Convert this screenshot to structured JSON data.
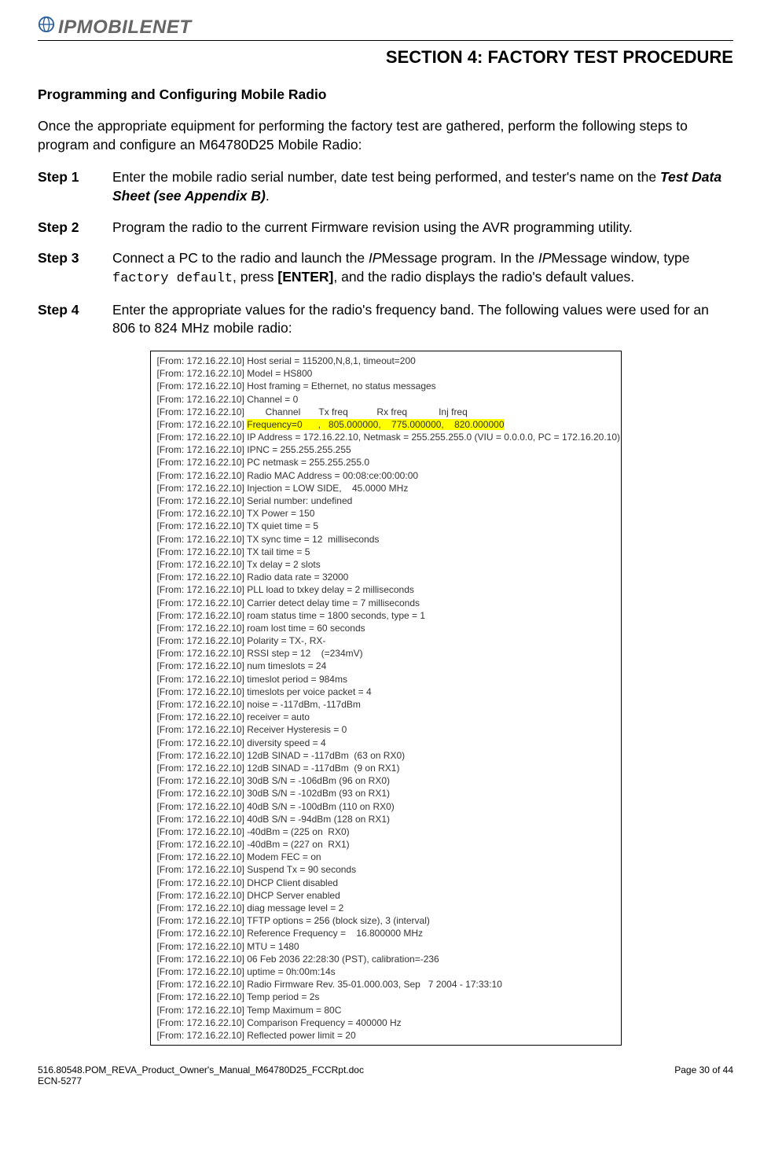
{
  "logo_text": "IPMOBILENET",
  "section_title": "SECTION 4: FACTORY TEST PROCEDURE",
  "subheading": "Programming and Configuring Mobile Radio",
  "intro": "Once the appropriate equipment for performing the factory test are gathered, perform the following steps to program and configure an M64780D25 Mobile Radio:",
  "steps": {
    "s1": {
      "label": "Step 1",
      "a": "Enter the mobile radio serial number, date test being performed, and tester's name on the ",
      "b": "Test Data Sheet (see Appendix B)",
      "c": "."
    },
    "s2": {
      "label": "Step 2",
      "a": "Program the radio to the current Firmware revision using the AVR programming utility."
    },
    "s3": {
      "label": "Step 3",
      "a": "Connect a PC to the radio and launch the ",
      "b": "IP",
      "c": "Message program.  In the ",
      "d": "IP",
      "e": "Message window, type ",
      "f": "factory default",
      "g": ", press ",
      "h": "[ENTER]",
      "i": ", and the radio displays the radio's default values."
    },
    "s4": {
      "label": "Step 4",
      "a": "Enter the appropriate values for the radio's frequency band.  The following values were used for an 806 to 824 MHz mobile radio:"
    }
  },
  "term_prefix": "[From: 172.16.22.10] ",
  "term": {
    "l1": "Host serial = 115200,N,8,1, timeout=200",
    "l2": "Model = HS800",
    "l3": "Host framing = Ethernet, no status messages",
    "l4": "Channel = 0",
    "l5": "       Channel       Tx freq           Rx freq            Inj freq",
    "l6a": "Frequency=0      ,   805.000000,    775.000000,    820.000000",
    "l7": "IP Address = 172.16.22.10, Netmask = 255.255.255.0 (VIU = 0.0.0.0, PC = 172.16.20.10)",
    "l8": "IPNC = 255.255.255.255",
    "l9": "PC netmask = 255.255.255.0",
    "l10": "Radio MAC Address = 00:08:ce:00:00:00",
    "l11": "Injection = LOW SIDE,    45.0000 MHz",
    "l12": "Serial number: undefined",
    "l13": "TX Power = 150",
    "l14": "TX quiet time = 5",
    "l15": "TX sync time = 12  milliseconds",
    "l16": "TX tail time = 5",
    "l17": "Tx delay = 2 slots",
    "l18": "Radio data rate = 32000",
    "l19": "PLL load to txkey delay = 2 milliseconds",
    "l20": "Carrier detect delay time = 7 milliseconds",
    "l21": "roam status time = 1800 seconds, type = 1",
    "l22": "roam lost time = 60 seconds",
    "l23": "Polarity = TX-, RX-",
    "l24": "RSSI step = 12    (=234mV)",
    "l25": "num timeslots = 24",
    "l26": "timeslot period = 984ms",
    "l27": "timeslots per voice packet = 4",
    "l28": "noise = -117dBm, -117dBm",
    "l29": "receiver = auto",
    "l30": "Receiver Hysteresis = 0",
    "l31": "diversity speed = 4",
    "l32": "12dB SINAD = -117dBm  (63 on RX0)",
    "l33": "12dB SINAD = -117dBm  (9 on RX1)",
    "l34": "30dB S/N = -106dBm (96 on RX0)",
    "l35": "30dB S/N = -102dBm (93 on RX1)",
    "l36": "40dB S/N = -100dBm (110 on RX0)",
    "l37": "40dB S/N = -94dBm (128 on RX1)",
    "l38": "-40dBm = (225 on  RX0)",
    "l39": "-40dBm = (227 on  RX1)",
    "l40": "Modem FEC = on",
    "l41": "Suspend Tx = 90 seconds",
    "l42": "DHCP Client disabled",
    "l43": "DHCP Server enabled",
    "l44": "diag message level = 2",
    "l45": "TFTP options = 256 (block size), 3 (interval)",
    "l46": "Reference Frequency =    16.800000 MHz",
    "l47": "MTU = 1480",
    "l48": "06 Feb 2036 22:28:30 (PST), calibration=-236",
    "l49": "uptime = 0h:00m:14s",
    "l50": "Radio Firmware Rev. 35-01.000.003, Sep   7 2004 - 17:33:10",
    "l51": "Temp period = 2s",
    "l52": "Temp Maximum = 80C",
    "l53": "Comparison Frequency = 400000 Hz",
    "l54": "Reflected power limit = 20"
  },
  "footer": {
    "left_line1": "516.80548.POM_REVA_Product_Owner's_Manual_M64780D25_FCCRpt.doc",
    "left_line2": "ECN-5277",
    "right_a": "Page 30 of  ",
    "right_b": "44"
  }
}
